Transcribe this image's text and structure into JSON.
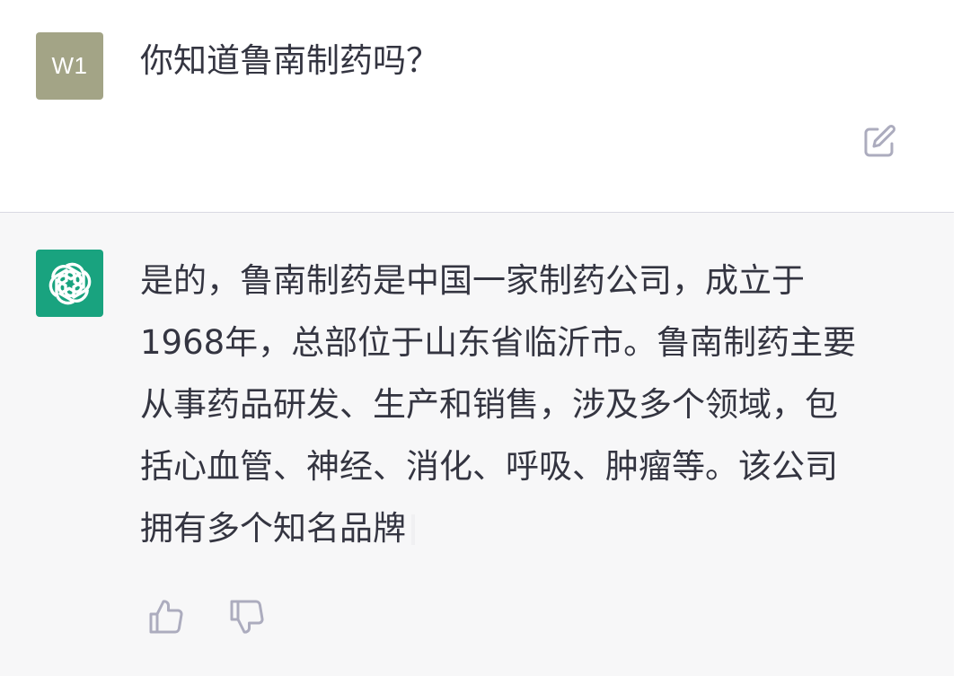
{
  "user_turn": {
    "avatar_initials": "W1",
    "avatar_color": "#a3a486",
    "message": "你知道鲁南制药吗？"
  },
  "assistant_turn": {
    "avatar_color": "#19a37f",
    "avatar_icon": "openai-logo-icon",
    "lines": [
      "是的，鲁南制药是中国一家制药公司，成立于",
      "1968年，总部位于山东省临沂市。鲁南制药主要",
      "从事药品研发、生产和销售，涉及多个领域，包",
      "括心血管、神经、消化、呼吸、肿瘤等。该公司",
      "拥有多个知名品牌"
    ]
  },
  "actions": {
    "edit_icon": "edit-icon",
    "thumbs_up_icon": "thumbs-up-icon",
    "thumbs_down_icon": "thumbs-down-icon"
  },
  "colors": {
    "user_bg": "#ffffff",
    "assistant_bg": "#f7f7f8",
    "text": "#343541",
    "icon": "#acacbe"
  }
}
